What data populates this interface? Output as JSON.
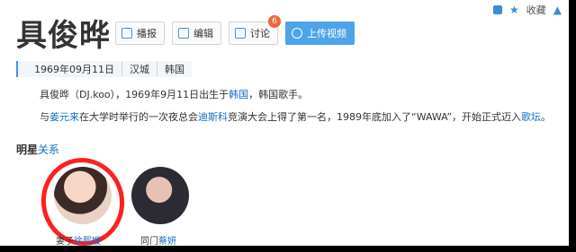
{
  "topbar": {
    "collect": "收藏"
  },
  "title": "具俊晔",
  "actions": {
    "broadcast": "播报",
    "edit": "编辑",
    "discuss": "讨论",
    "discuss_count": "6",
    "upload_video": "上传视频"
  },
  "meta": [
    "1969年09月11日",
    "汉城",
    "韩国"
  ],
  "para1": {
    "pre": "具俊晔（DJ.koo），1969年9月11日出生于",
    "link": "韩国",
    "post": "，韩国歌手。"
  },
  "para2": {
    "pre": "与",
    "link1": "姜元来",
    "mid1": "在大学时举行的一次夜总会",
    "link2": "迪斯科",
    "mid2": "竞演大会上得了第一名，1989年底加入了“WAWA”，开始正式迈入",
    "link3": "歌坛",
    "post": "。"
  },
  "relations": {
    "title_prefix": "明星",
    "title_link": "关系",
    "items": [
      {
        "role": "妻子",
        "name": "徐熙媛"
      },
      {
        "role": "同门",
        "name": "蔡妍"
      }
    ]
  }
}
